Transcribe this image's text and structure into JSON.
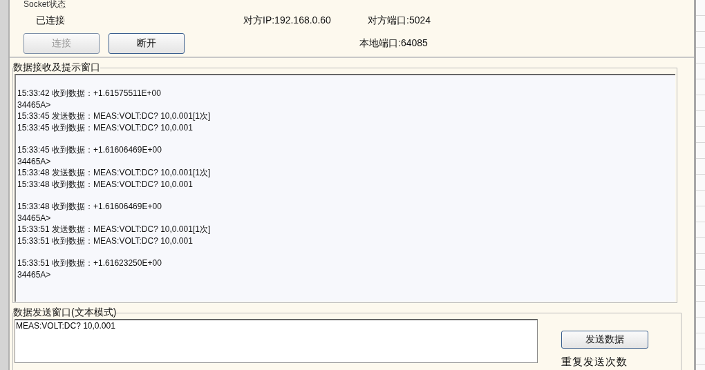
{
  "socket_group": {
    "title": "Socket状态",
    "status": "已连接",
    "remote_ip": "对方IP:192.168.0.60",
    "remote_port": "对方端口:5024",
    "local_port": "本地端口:64085",
    "buttons": [
      {
        "label": "连接",
        "disabled": true
      },
      {
        "label": "断开",
        "disabled": false
      }
    ]
  },
  "receive_group": {
    "title": "数据接收及提示窗口",
    "blocks": [
      {
        "lines": [
          "15:33:42 收到数据：+1.61575511E+00",
          "34465A>",
          "15:33:45 发送数据：MEAS:VOLT:DC? 10,0.001[1次]",
          "15:33:45 收到数据：MEAS:VOLT:DC? 10,0.001"
        ]
      },
      {
        "lines": [
          "15:33:45 收到数据：+1.61606469E+00",
          "34465A>",
          "15:33:48 发送数据：MEAS:VOLT:DC? 10,0.001[1次]",
          "15:33:48 收到数据：MEAS:VOLT:DC? 10,0.001"
        ]
      },
      {
        "lines": [
          "15:33:48 收到数据：+1.61606469E+00",
          "34465A>",
          "15:33:51 发送数据：MEAS:VOLT:DC? 10,0.001[1次]",
          "15:33:51 收到数据：MEAS:VOLT:DC? 10,0.001"
        ]
      },
      {
        "lines": [
          "15:33:51 收到数据：+1.61623250E+00",
          "34465A>"
        ]
      }
    ]
  },
  "send_group": {
    "title": "数据发送窗口(文本模式)",
    "value": "MEAS:VOLT:DC? 10,0.001",
    "send_button": "发送数据",
    "repeat_label": "重复发送次数"
  }
}
